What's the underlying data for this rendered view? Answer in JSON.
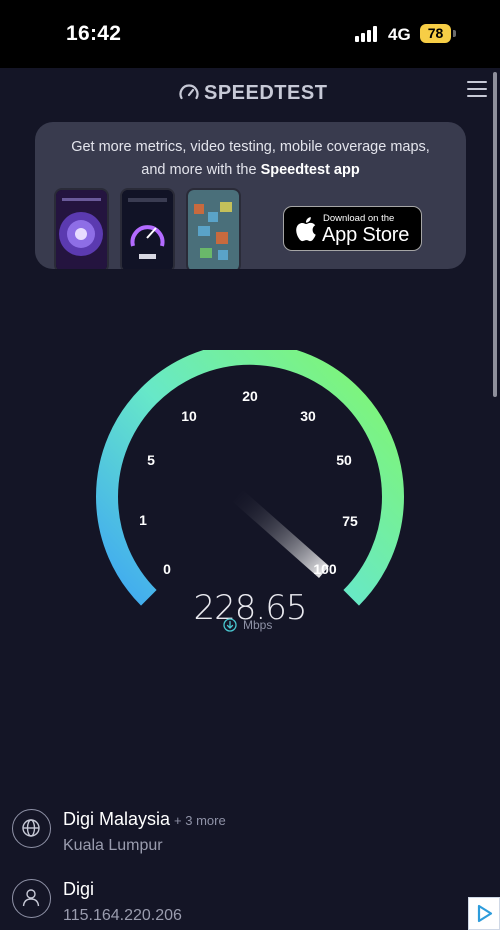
{
  "status_bar": {
    "time": "16:42",
    "network": "4G",
    "battery": "78"
  },
  "header": {
    "logo_text": "SPEEDTEST"
  },
  "promo": {
    "text_line1": "Get more metrics, video testing, mobile coverage maps,",
    "text_line2_prefix": "and more with the ",
    "text_line2_bold": "Speedtest app",
    "store_small": "Download on the",
    "store_big": "App Store"
  },
  "gauge": {
    "ticks": [
      "0",
      "1",
      "5",
      "10",
      "20",
      "30",
      "50",
      "75",
      "100"
    ],
    "value": "228.65",
    "unit": "Mbps",
    "colors": {
      "start": "#3ea6f3",
      "mid": "#67e8c8",
      "end": "#7ff577"
    }
  },
  "isp": {
    "name": "Digi Malaysia",
    "more": "+ 3 more",
    "location": "Kuala Lumpur"
  },
  "client": {
    "name": "Digi",
    "ip": "115.164.220.206"
  }
}
